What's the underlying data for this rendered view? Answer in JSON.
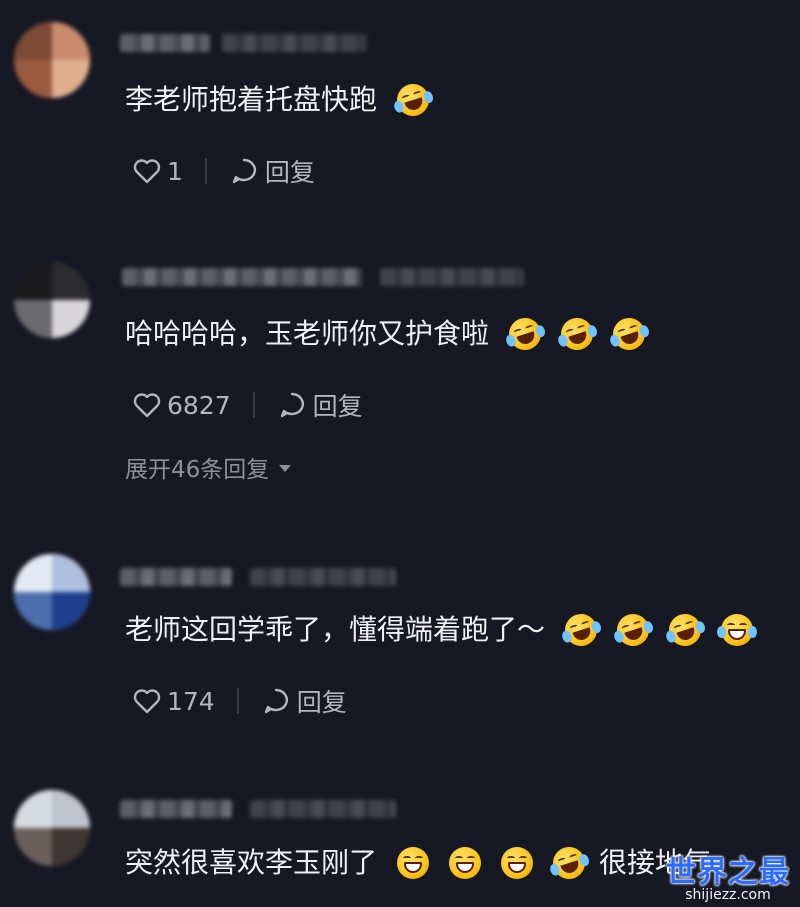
{
  "comments": [
    {
      "text": "李老师抱着托盘快跑",
      "likes": "1",
      "reply_label": "回复",
      "emojis": [
        "laugh-cry"
      ]
    },
    {
      "text": "哈哈哈哈，玉老师你又护食啦",
      "likes": "6827",
      "reply_label": "回复",
      "expand_label": "展开46条回复",
      "emojis": [
        "laugh-cry",
        "laugh-cry",
        "laugh-cry"
      ]
    },
    {
      "text": "老师这回学乖了，懂得端着跑了～",
      "likes": "174",
      "reply_label": "回复",
      "emojis": [
        "laugh-cry",
        "laugh-cry",
        "laugh-cry",
        "laugh-tears"
      ]
    },
    {
      "text": "突然很喜欢李玉刚了",
      "text_after": "很接地气",
      "emojis": [
        "grin",
        "grin",
        "grin",
        "laugh-cry"
      ]
    }
  ],
  "watermark": {
    "title": "世界之最",
    "url": "shijiezz.com"
  },
  "colors": {
    "background": "#161823",
    "text": "#eef0f3",
    "muted": "#b4b6bd",
    "watermark": "#2b6cff"
  }
}
